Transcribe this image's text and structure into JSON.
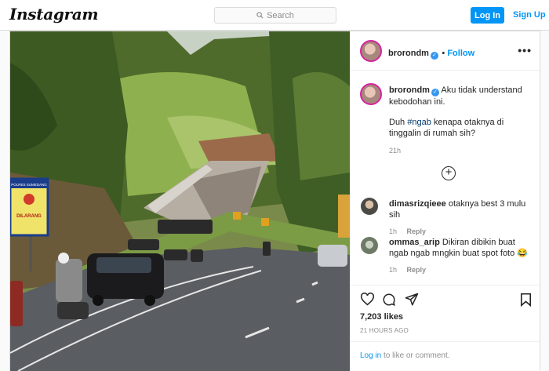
{
  "topbar": {
    "logo": "Instagram",
    "search_placeholder": "Search",
    "login_label": "Log In",
    "signup_label": "Sign Up"
  },
  "post": {
    "username": "brorondm",
    "follow_label": "Follow",
    "caption_line1": "Aku tidak understand kebodohan ini.",
    "caption_line2_before": "Duh ",
    "hashtag": "#ngab",
    "caption_line2_after": " kenapa otaknya di tinggalin di rumah sih?",
    "caption_time": "21h",
    "comments": [
      {
        "user": "dimasrizqieee",
        "text": "otaknya best 3 mulu sih",
        "time": "1h",
        "reply": "Reply"
      },
      {
        "user": "ommas_arip",
        "text": "Dikiran dibikin buat ngab ngab mngkin buat spot foto",
        "emoji": "😂",
        "time": "1h",
        "reply": "Reply"
      }
    ],
    "likes": "7,203 likes",
    "timestamp": "21 HOURS AGO",
    "login_link": "Log in",
    "login_prompt": " to like or comment."
  },
  "photo": {
    "sign_text": "DILARANG",
    "sign_small": "POLRES SUMEDANG"
  },
  "colors": {
    "accent": "#0095f6",
    "border": "#dbdbdb",
    "muted": "#8e8e8e"
  },
  "icons": [
    "search-icon",
    "verified-icon",
    "more-icon",
    "add-comment-icon",
    "heart-icon",
    "comment-icon",
    "share-icon",
    "bookmark-icon"
  ]
}
